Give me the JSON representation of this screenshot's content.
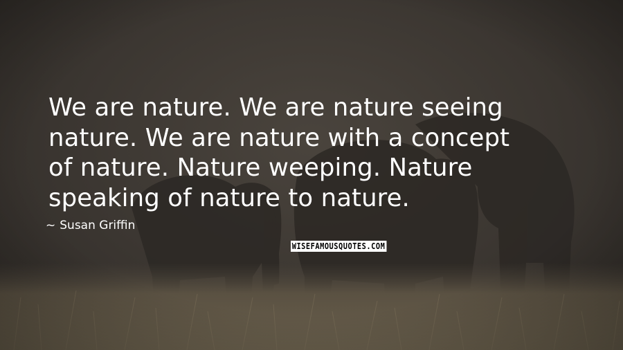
{
  "quote": {
    "text": "We are nature. We are nature seeing\nnature. We are nature with a concept\nof nature. Nature weeping. Nature\nspeaking of nature to nature.",
    "author_dash": "~",
    "author": "Susan Griffin"
  },
  "watermark": {
    "text": "WISEFAMOUSQUOTES.COM"
  },
  "colors": {
    "background": "#3b3631",
    "text": "#ffffff"
  }
}
